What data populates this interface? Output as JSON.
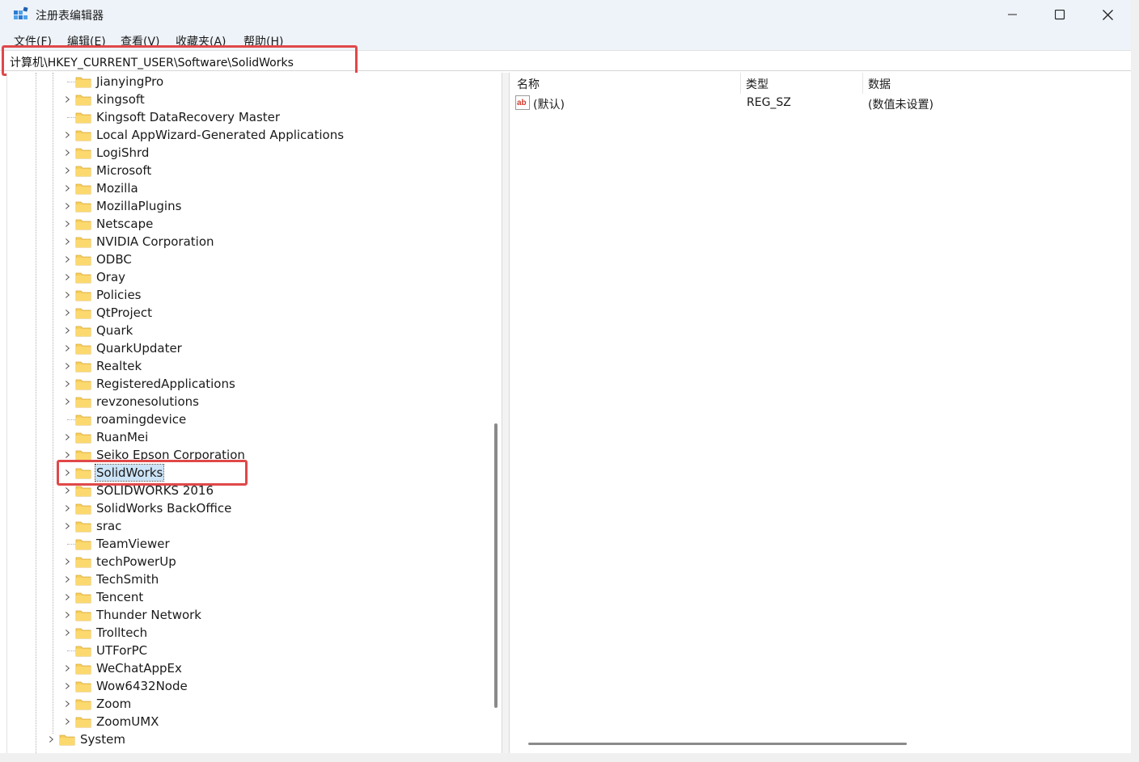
{
  "window": {
    "title": "注册表编辑器",
    "controls": {
      "minimize": "minimize",
      "maximize": "maximize",
      "close": "close"
    }
  },
  "menu": {
    "items": [
      "文件(F)",
      "编辑(E)",
      "查看(V)",
      "收藏夹(A)",
      "帮助(H)"
    ]
  },
  "address": {
    "path": "计算机\\HKEY_CURRENT_USER\\Software\\SolidWorks"
  },
  "tree": {
    "items": [
      {
        "label": "JianyingPro",
        "expandable": false
      },
      {
        "label": "kingsoft",
        "expandable": true
      },
      {
        "label": "Kingsoft DataRecovery Master",
        "expandable": false
      },
      {
        "label": "Local AppWizard-Generated Applications",
        "expandable": true
      },
      {
        "label": "LogiShrd",
        "expandable": true
      },
      {
        "label": "Microsoft",
        "expandable": true
      },
      {
        "label": "Mozilla",
        "expandable": true
      },
      {
        "label": "MozillaPlugins",
        "expandable": true
      },
      {
        "label": "Netscape",
        "expandable": true
      },
      {
        "label": "NVIDIA Corporation",
        "expandable": true
      },
      {
        "label": "ODBC",
        "expandable": true
      },
      {
        "label": "Oray",
        "expandable": true
      },
      {
        "label": "Policies",
        "expandable": true
      },
      {
        "label": "QtProject",
        "expandable": true
      },
      {
        "label": "Quark",
        "expandable": true
      },
      {
        "label": "QuarkUpdater",
        "expandable": true
      },
      {
        "label": "Realtek",
        "expandable": true
      },
      {
        "label": "RegisteredApplications",
        "expandable": true
      },
      {
        "label": "revzonesolutions",
        "expandable": true
      },
      {
        "label": "roamingdevice",
        "expandable": false
      },
      {
        "label": "RuanMei",
        "expandable": true
      },
      {
        "label": "Seiko Epson Corporation",
        "expandable": true
      },
      {
        "label": "SolidWorks",
        "expandable": true,
        "selected": true
      },
      {
        "label": "SOLIDWORKS 2016",
        "expandable": true
      },
      {
        "label": "SolidWorks BackOffice",
        "expandable": true
      },
      {
        "label": "srac",
        "expandable": true
      },
      {
        "label": "TeamViewer",
        "expandable": false
      },
      {
        "label": "techPowerUp",
        "expandable": true
      },
      {
        "label": "TechSmith",
        "expandable": true
      },
      {
        "label": "Tencent",
        "expandable": true
      },
      {
        "label": "Thunder Network",
        "expandable": true
      },
      {
        "label": "Trolltech",
        "expandable": true
      },
      {
        "label": "UTForPC",
        "expandable": false
      },
      {
        "label": "WeChatAppEx",
        "expandable": true
      },
      {
        "label": "Wow6432Node",
        "expandable": true
      },
      {
        "label": "Zoom",
        "expandable": true
      },
      {
        "label": "ZoomUMX",
        "expandable": true
      }
    ],
    "root_sibling": {
      "label": "System",
      "expandable": true
    }
  },
  "list": {
    "columns": [
      "名称",
      "类型",
      "数据"
    ],
    "rows": [
      {
        "name": "(默认)",
        "type": "REG_SZ",
        "data": "(数值未设置)",
        "icon": "string-value-icon"
      }
    ]
  },
  "colors": {
    "title_bg": "#eef3f9",
    "highlight_red": "#e0484a",
    "selection_bg": "#cce4f7",
    "folder_yellow": "#f8cf5b"
  }
}
